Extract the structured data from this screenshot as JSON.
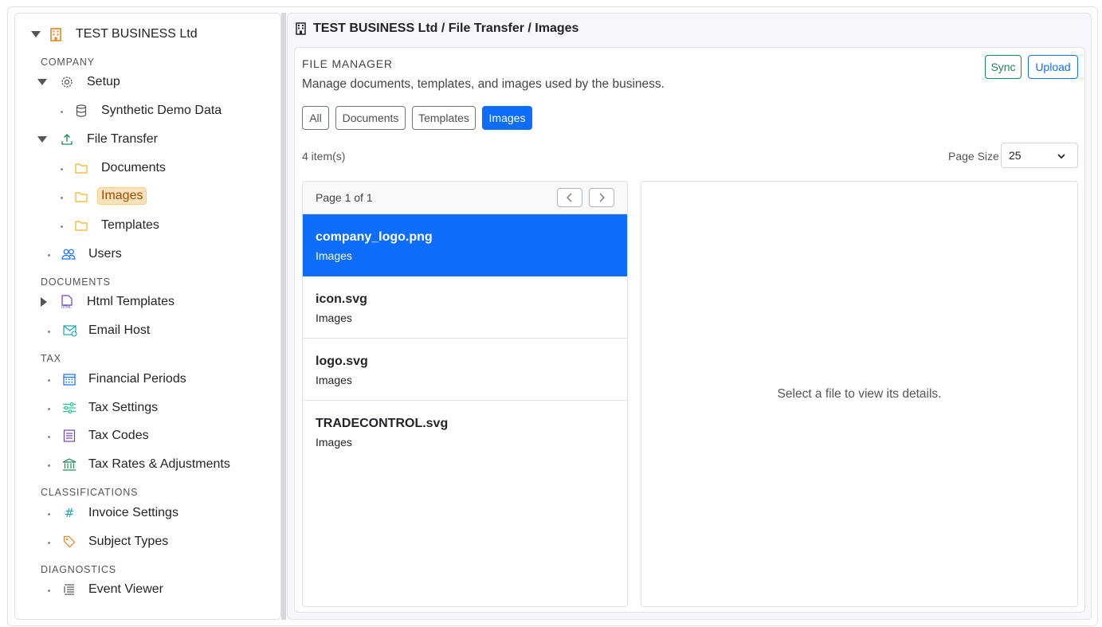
{
  "sidebar": {
    "root": {
      "label": "TEST BUSINESS Ltd",
      "icon": "building-icon"
    },
    "sections": {
      "company": "COMPANY",
      "documents": "DOCUMENTS",
      "tax": "TAX",
      "classifications": "CLASSIFICATIONS",
      "diagnostics": "DIAGNOSTICS"
    },
    "items": {
      "setup": "Setup",
      "synthetic": "Synthetic Demo Data",
      "file_transfer": "File Transfer",
      "documents": "Documents",
      "images": "Images",
      "templates": "Templates",
      "users": "Users",
      "html_templates": "Html Templates",
      "email_host": "Email Host",
      "financial_periods": "Financial Periods",
      "tax_settings": "Tax Settings",
      "tax_codes": "Tax Codes",
      "tax_rates": "Tax Rates & Adjustments",
      "invoice_settings": "Invoice Settings",
      "subject_types": "Subject Types",
      "event_viewer": "Event Viewer"
    },
    "selected": "images"
  },
  "main": {
    "breadcrumb": "TEST BUSINESS Ltd / File Transfer / Images",
    "title": "FILE MANAGER",
    "description": "Manage documents, templates, and images used by the business.",
    "buttons": {
      "sync": "Sync",
      "upload": "Upload"
    },
    "filters": [
      "All",
      "Documents",
      "Templates",
      "Images"
    ],
    "active_filter": "Images",
    "item_count": "4 item(s)",
    "page_size_label": "Page Size",
    "page_size_value": "25",
    "pager": "Page 1 of 1",
    "files": [
      {
        "name": "company_logo.png",
        "type": "Images"
      },
      {
        "name": "icon.svg",
        "type": "Images"
      },
      {
        "name": "logo.svg",
        "type": "Images"
      },
      {
        "name": "TRADECONTROL.svg",
        "type": "Images"
      }
    ],
    "selected_file": "company_logo.png",
    "detail_placeholder": "Select a file to view its details."
  },
  "colors": {
    "primary": "#0d6efd",
    "success": "#198754",
    "selected_tree_bg": "#fde1b8",
    "folder": "#f0b429"
  }
}
